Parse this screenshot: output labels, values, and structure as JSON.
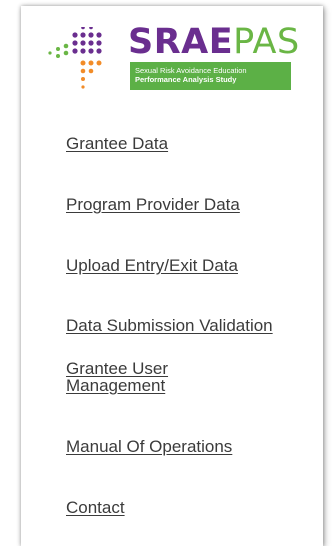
{
  "logo": {
    "word_part1": "SRAE",
    "word_part2": "PAS",
    "tagline_line1": "Sexual Risk Avoidance Education",
    "tagline_line2": "Performance Analysis Study",
    "colors": {
      "purple": "#6a2e8f",
      "green": "#5cb046",
      "orange": "#f28c28"
    }
  },
  "nav": {
    "items": [
      {
        "label": "Grantee Data"
      },
      {
        "label": "Program Provider Data"
      },
      {
        "label": "Upload Entry/Exit Data"
      },
      {
        "label": "Data Submission Validation"
      },
      {
        "label": "Grantee User Management"
      },
      {
        "label": "Manual Of Operations"
      },
      {
        "label": "Contact"
      }
    ]
  }
}
